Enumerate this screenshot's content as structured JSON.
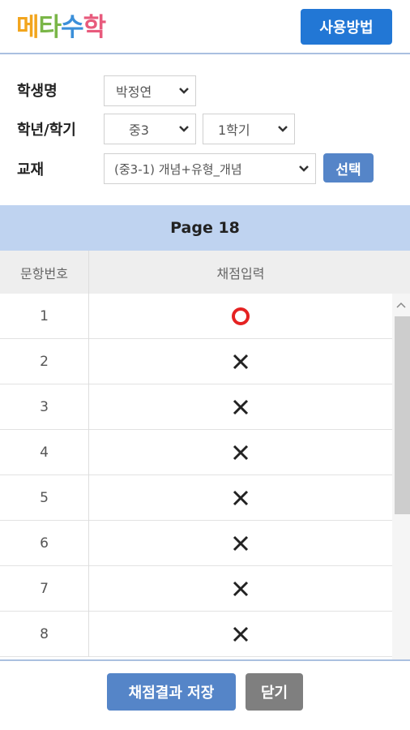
{
  "header": {
    "logo": {
      "chars": [
        "메",
        "타",
        "수",
        "학"
      ],
      "colors": [
        "#f2a51d",
        "#7ab648",
        "#3b8fd9",
        "#e85a7c"
      ]
    },
    "help_button": "사용방법"
  },
  "form": {
    "student_label": "학생명",
    "student_value": "박정연",
    "grade_label": "학년/학기",
    "grade_value": "중3",
    "semester_value": "1학기",
    "textbook_label": "교재",
    "textbook_value": "(중3-1) 개념+유형_개념",
    "select_button": "선택"
  },
  "page_title": "Page 18",
  "table": {
    "col_number": "문항번호",
    "col_grade": "채점입력",
    "rows": [
      {
        "num": "1",
        "mark": "O"
      },
      {
        "num": "2",
        "mark": "X"
      },
      {
        "num": "3",
        "mark": "X"
      },
      {
        "num": "4",
        "mark": "X"
      },
      {
        "num": "5",
        "mark": "X"
      },
      {
        "num": "6",
        "mark": "X"
      },
      {
        "num": "7",
        "mark": "X"
      },
      {
        "num": "8",
        "mark": "X"
      }
    ]
  },
  "footer": {
    "save_button": "채점결과 저장",
    "close_button": "닫기"
  },
  "colors": {
    "accent": "#2277d5",
    "secondary": "#5585c8",
    "correct": "#e52222",
    "wrong": "#222222"
  }
}
